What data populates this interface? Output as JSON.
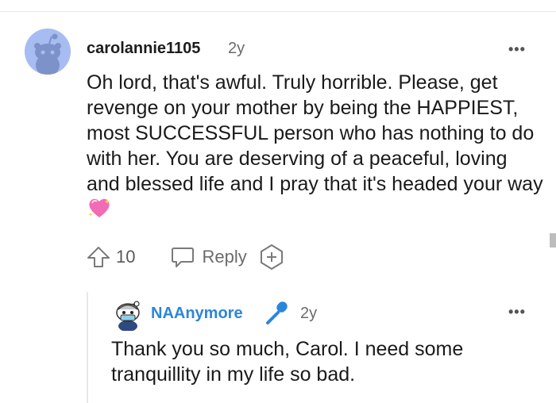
{
  "comment": {
    "username": "carolannie1105",
    "age": "2y",
    "more_label": "•••",
    "body": "Oh lord, that's awful. Truly horrible. Please, get revenge on your mother by being the HAPPIEST, most SUCCESSFUL person who has nothing to do with her. You are deserving of a peaceful, loving and blessed life and I pray that it's headed your way",
    "emoji": "sparkling-heart-icon",
    "vote_count": "10",
    "reply_label": "Reply"
  },
  "reply": {
    "username": "NAAnymore",
    "badge_icon": "microphone-icon",
    "age": "2y",
    "more_label": "•••",
    "body": "Thank you so much, Carol. I need some tranquillity in my life so bad."
  },
  "colors": {
    "avatar_bg": "#a7bdf2",
    "reply_username": "#2b86d9",
    "mic_icon": "#2b86d9",
    "emoji_heart": "#f26bb5"
  }
}
